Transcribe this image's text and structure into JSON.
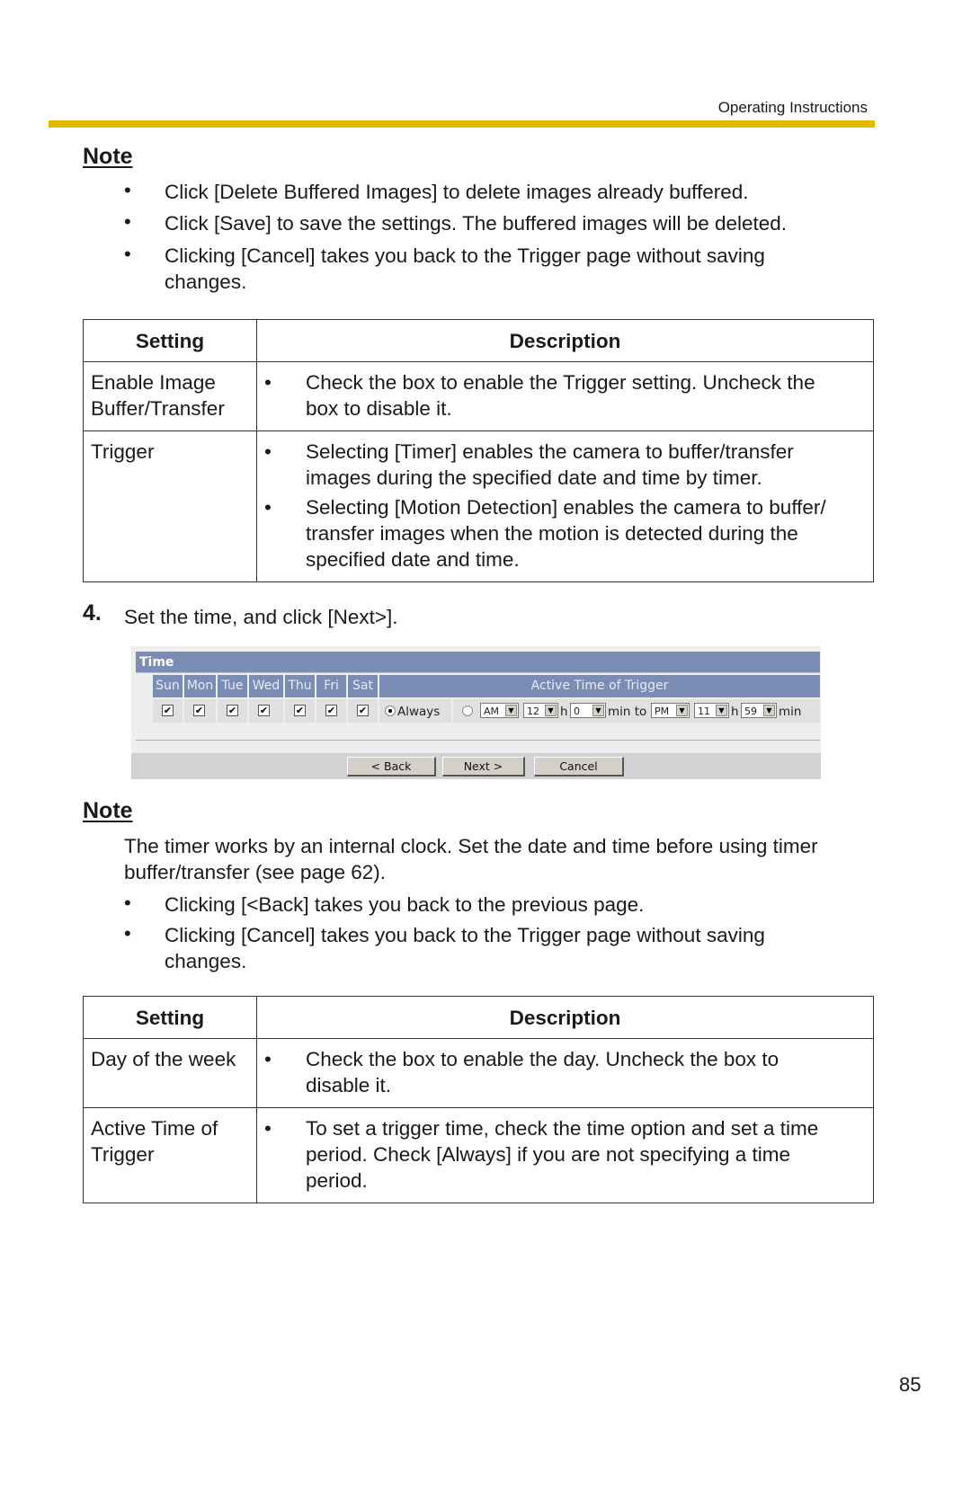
{
  "header": {
    "title": "Operating Instructions",
    "accent_color": "#e3b800"
  },
  "note1": {
    "heading": "Note",
    "bullets": [
      "Click [Delete Buffered Images] to delete images already buffered.",
      "Click [Save] to save the settings. The buffered images will be deleted.",
      "Clicking [Cancel] takes you back to the Trigger page without saving",
      "changes."
    ],
    "bullet_glyph": "•"
  },
  "table1": {
    "headers": [
      "Setting",
      "Description"
    ],
    "rows": [
      {
        "setting": [
          "Enable Image",
          "Buffer/Transfer"
        ],
        "items": [
          [
            "Check the box to enable the Trigger setting. Uncheck the",
            "box to disable it."
          ]
        ]
      },
      {
        "setting": [
          "Trigger"
        ],
        "items": [
          [
            "Selecting [Timer] enables the camera to buffer/transfer",
            "images during the specified date and time by timer."
          ],
          [
            "Selecting [Motion Detection] enables the camera to buffer/",
            "transfer images when the motion is detected during the",
            "specified date and time."
          ]
        ]
      }
    ]
  },
  "step4": {
    "number": "4.",
    "text": "Set the time, and click [Next>]."
  },
  "time_ui": {
    "title": "Time",
    "days": [
      {
        "label": "Sun",
        "checked": true
      },
      {
        "label": "Mon",
        "checked": true
      },
      {
        "label": "Tue",
        "checked": true
      },
      {
        "label": "Wed",
        "checked": true
      },
      {
        "label": "Thu",
        "checked": true
      },
      {
        "label": "Fri",
        "checked": true
      },
      {
        "label": "Sat",
        "checked": true
      }
    ],
    "active_time_header": "Active Time of Trigger",
    "always_label": "Always",
    "always_selected": true,
    "check_mark": "✔",
    "dropdown_arrow": "▼",
    "from": {
      "ampm": "AM",
      "hour": "12",
      "hour_unit": "h",
      "min": "0",
      "min_unit": "min to"
    },
    "to": {
      "ampm": "PM",
      "hour": "11",
      "hour_unit": "h",
      "min": "59",
      "min_unit": "min"
    },
    "buttons": {
      "back": "< Back",
      "next": "Next >",
      "cancel": "Cancel"
    },
    "colors": {
      "header_blue": "#7b8db5",
      "panel_gray": "#eeeeee",
      "button_bar": "#d2d2d2"
    }
  },
  "note2": {
    "heading": "Note",
    "paragraph": [
      "The timer works by an internal clock. Set the date and time before using timer",
      "buffer/transfer (see page 62)."
    ],
    "bullets": [
      "Clicking [<Back] takes you back to the previous page.",
      "Clicking [Cancel] takes you back to the Trigger page without saving",
      "changes."
    ]
  },
  "table2": {
    "headers": [
      "Setting",
      "Description"
    ],
    "rows": [
      {
        "setting": [
          "Day of the week"
        ],
        "items": [
          [
            "Check the box to enable the day. Uncheck the box to",
            "disable it."
          ]
        ]
      },
      {
        "setting": [
          "Active Time of",
          "Trigger"
        ],
        "items": [
          [
            "To set a trigger time, check the time option and set a time",
            "period. Check [Always] if you are not specifying a time",
            "period."
          ]
        ]
      }
    ]
  },
  "page_number": "85"
}
